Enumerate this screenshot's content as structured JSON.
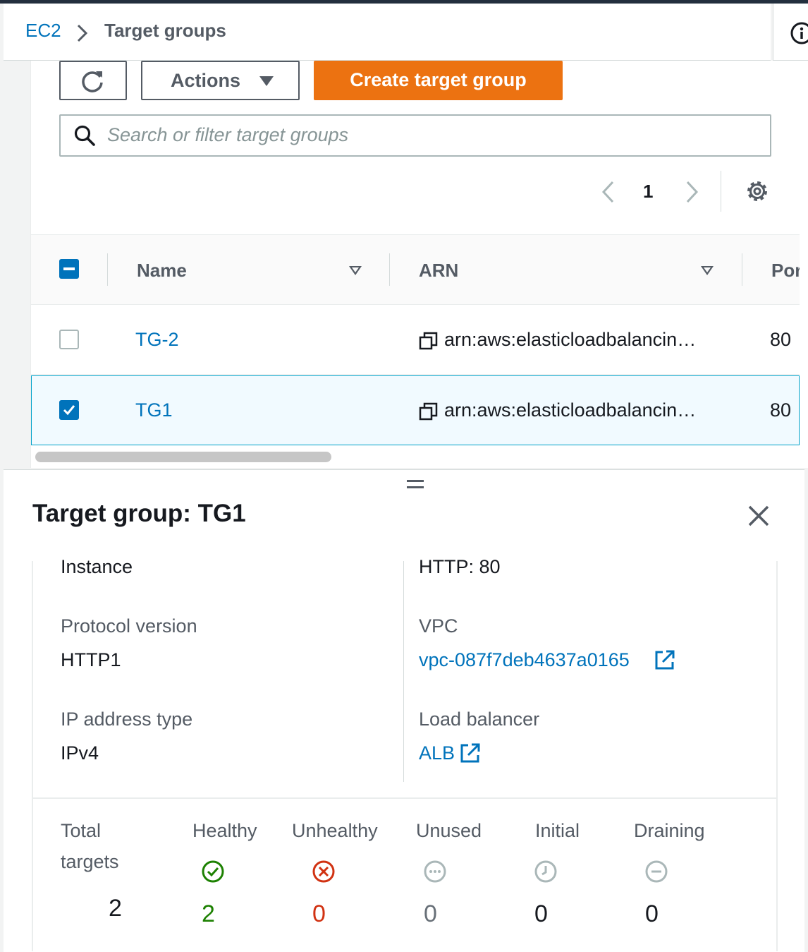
{
  "breadcrumb": {
    "root": "EC2",
    "current": "Target groups"
  },
  "toolbar": {
    "refresh_icon": "refresh-icon",
    "actions_label": "Actions",
    "create_label": "Create target group"
  },
  "search": {
    "placeholder": "Search or filter target groups"
  },
  "pagination": {
    "current_page": "1"
  },
  "table": {
    "columns": [
      "Name",
      "ARN",
      "Por"
    ],
    "rows": [
      {
        "selected": false,
        "name": "TG-2",
        "arn": "arn:aws:elasticloadbalancin…",
        "port": "80"
      },
      {
        "selected": true,
        "name": "TG1",
        "arn": "arn:aws:elasticloadbalancin…",
        "port": "80"
      }
    ]
  },
  "split_panel": {
    "title": "Target group: TG1",
    "left": {
      "target_type_value": "Instance",
      "protocol_version_label": "Protocol version",
      "protocol_version_value": "HTTP1",
      "ip_type_label": "IP address type",
      "ip_type_value": "IPv4"
    },
    "right": {
      "protocol_port_value": "HTTP: 80",
      "vpc_label": "VPC",
      "vpc_value": "vpc-087f7deb4637a0165",
      "lb_label": "Load balancer",
      "lb_value": "ALB"
    },
    "stats": {
      "total_label_1": "Total",
      "total_label_2": "targets",
      "total_value": "2",
      "healthy_label": "Healthy",
      "healthy_value": "2",
      "unhealthy_label": "Unhealthy",
      "unhealthy_value": "0",
      "unused_label": "Unused",
      "unused_value": "0",
      "initial_label": "Initial",
      "initial_value": "0",
      "draining_label": "Draining",
      "draining_value": "0"
    }
  },
  "colors": {
    "link": "#0073bb",
    "primary_button": "#ec7211",
    "healthy": "#1d8102",
    "unhealthy": "#d13212",
    "neutral": "#aab7b8"
  }
}
